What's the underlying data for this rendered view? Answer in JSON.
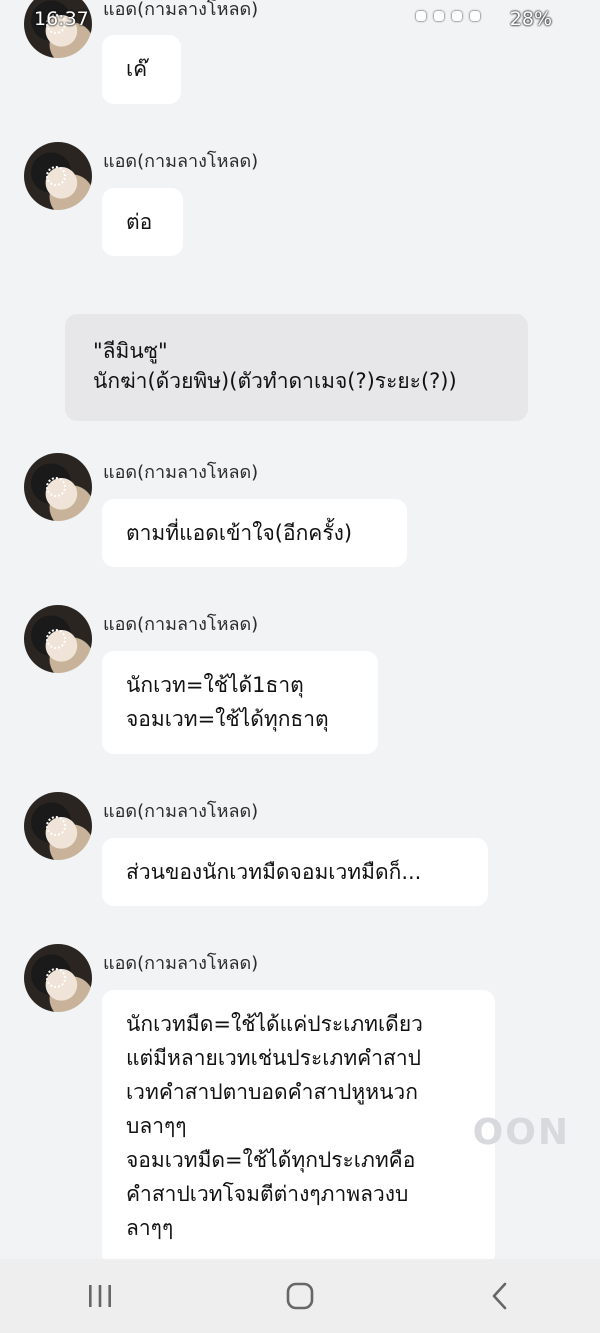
{
  "status_bar": {
    "time": "16:37",
    "battery": "28%"
  },
  "messages": [
    {
      "sender": "แอด(กามลางโหลด)",
      "lines": [
        "เค๊"
      ]
    },
    {
      "sender": "แอด(กามลางโหลด)",
      "lines": [
        "ต่อ"
      ]
    },
    {
      "sender": "แอด(กามลางโหลด)",
      "lines": [
        "ตามที่แอดเข้าใจ(อีกครั้ง)"
      ]
    },
    {
      "sender": "แอด(กามลางโหลด)",
      "lines": [
        "นักเวท=ใช้ได้1ธาตุ",
        "จอมเวท=ใช้ได้ทุกธาตุ"
      ]
    },
    {
      "sender": "แอด(กามลางโหลด)",
      "lines": [
        "ส่วนของนักเวทมืดจอมเวทมืดก็..."
      ]
    },
    {
      "sender": "แอด(กามลางโหลด)",
      "lines": [
        "นักเวทมืด=ใช้ได้แค่ประเภทเดียว",
        "แต่มีหลายเวทเช่นประเภทคำสาป",
        "เวทคำสาปตาบอดคำสาปหูหนวก",
        "บลาๆๆ",
        "จอมเวทมืด=ใช้ได้ทุกประเภทคือ",
        "คำสาปเวทโจมตีต่างๆภาพลวงบ",
        "ลาๆๆ"
      ]
    }
  ],
  "notice": {
    "lines": [
      "\"ลีมินซู\"",
      "นักฆ่า(ด้วยพิษ)(ตัวทำดาเมจ(?)ระยะ(?))"
    ]
  },
  "watermark": "OON",
  "nav": {
    "recent_icon": "recent-apps-icon",
    "home_icon": "home-icon",
    "back_icon": "back-icon"
  }
}
